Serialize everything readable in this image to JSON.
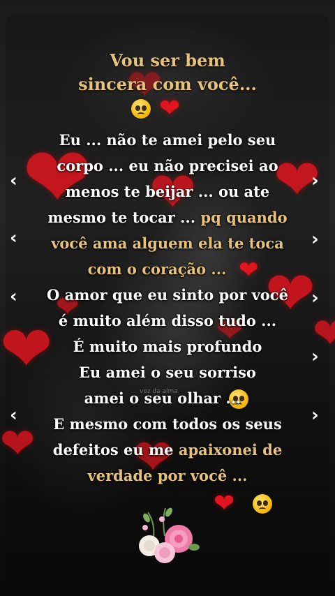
{
  "title_lines": [
    "Vou ser bem",
    "sincera com você..."
  ],
  "body_lines": [
    {
      "text": "Eu ... não te amei pelo seu"
    },
    {
      "text": "corpo ...  eu não precisei ao"
    },
    {
      "text": "menos te beijar ... ou ate"
    },
    {
      "pre": "mesmo te tocar ... ",
      "gold": "pq quando"
    },
    {
      "gold": "você ama alguem ela te toca"
    },
    {
      "gold": "com o coração ..."
    },
    {
      "text": "O amor que eu sinto por você"
    },
    {
      "text": "é muito além disso tudo ..."
    },
    {
      "text": "É muito mais profundo"
    },
    {
      "text": "Eu amei o seu sorriso"
    },
    {
      "text": "amei o seu olhar ..."
    },
    {
      "text": "E mesmo com todos os seus"
    },
    {
      "text": "defeitos eu me ",
      "gold": "apaixonei de"
    },
    {
      "gold": "verdade por você ..."
    }
  ],
  "watermark": "voz da alma",
  "icons": {
    "heart": "heart-icon",
    "pleading_face": "pleading-face-emoji-icon",
    "chevron_left": "chevron-left-icon",
    "chevron_right": "chevron-right-icon",
    "flowers": "flower-bouquet-icon"
  },
  "colors": {
    "gold": "#e6c27a",
    "heart_red": "#e0151f",
    "text": "#ffffff"
  }
}
